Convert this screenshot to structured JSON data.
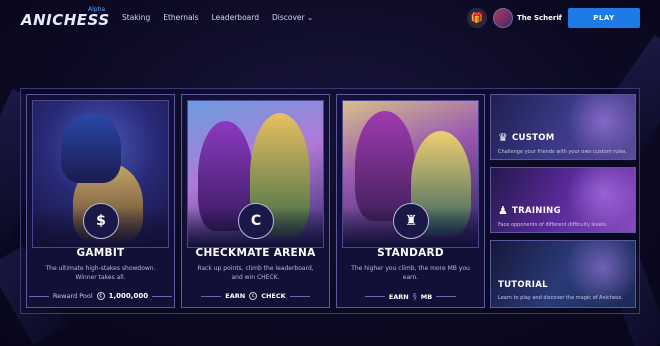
{
  "header": {
    "logo": "ANICHESS",
    "logo_tag": "Alpha",
    "nav": [
      "Staking",
      "Ethernals",
      "Leaderboard",
      "Discover"
    ],
    "user_name": "The Scherif",
    "play_label": "PLAY"
  },
  "modes": [
    {
      "title": "GAMBIT",
      "desc": "The ultimate high-stakes showdown. Winner takes all.",
      "foot_label": "Reward Pool",
      "foot_value": "1,000,000"
    },
    {
      "title": "CHECKMATE ARENA",
      "desc": "Rack up points, climb the leaderboard, and win CHECK.",
      "foot_label": "EARN",
      "foot_value": "CHECK"
    },
    {
      "title": "STANDARD",
      "desc": "The higher you climb, the more MB you earn.",
      "foot_label": "EARN",
      "foot_value": "MB"
    }
  ],
  "side_modes": [
    {
      "title": "CUSTOM",
      "desc": "Challenge your friends with your own custom rules."
    },
    {
      "title": "TRAINING",
      "desc": "Face opponents of different difficulty levels."
    },
    {
      "title": "TUTORIAL",
      "desc": "Learn to play and discover the magic of Anichess."
    }
  ],
  "colors": {
    "accent": "#1e7be6",
    "background": "#0d0b24",
    "card_border": "#5c58a0"
  }
}
